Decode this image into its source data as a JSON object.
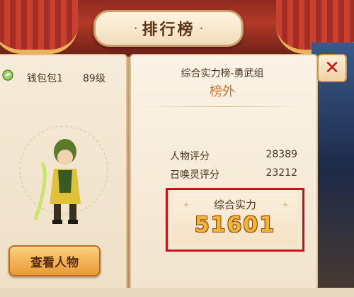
{
  "header": {
    "title_chars": [
      "排",
      "行",
      "榜"
    ]
  },
  "player": {
    "name": "钱包包1",
    "level": "89级"
  },
  "actions": {
    "view_character": "查看人物"
  },
  "ranking": {
    "board_title": "综合实力榜-勇武组",
    "status": "榜外",
    "stats": [
      {
        "label": "人物评分",
        "value": "28389"
      },
      {
        "label": "召唤灵评分",
        "value": "23212"
      }
    ],
    "total_label": "综合实力",
    "total_value": "51601"
  },
  "close_symbol": "✕",
  "icons": {
    "pet": "leaf-pet-icon",
    "close": "close-icon"
  },
  "colors": {
    "status_orange": "#d9731f",
    "highlight_red": "#d01010",
    "gold": "#f3b436"
  }
}
